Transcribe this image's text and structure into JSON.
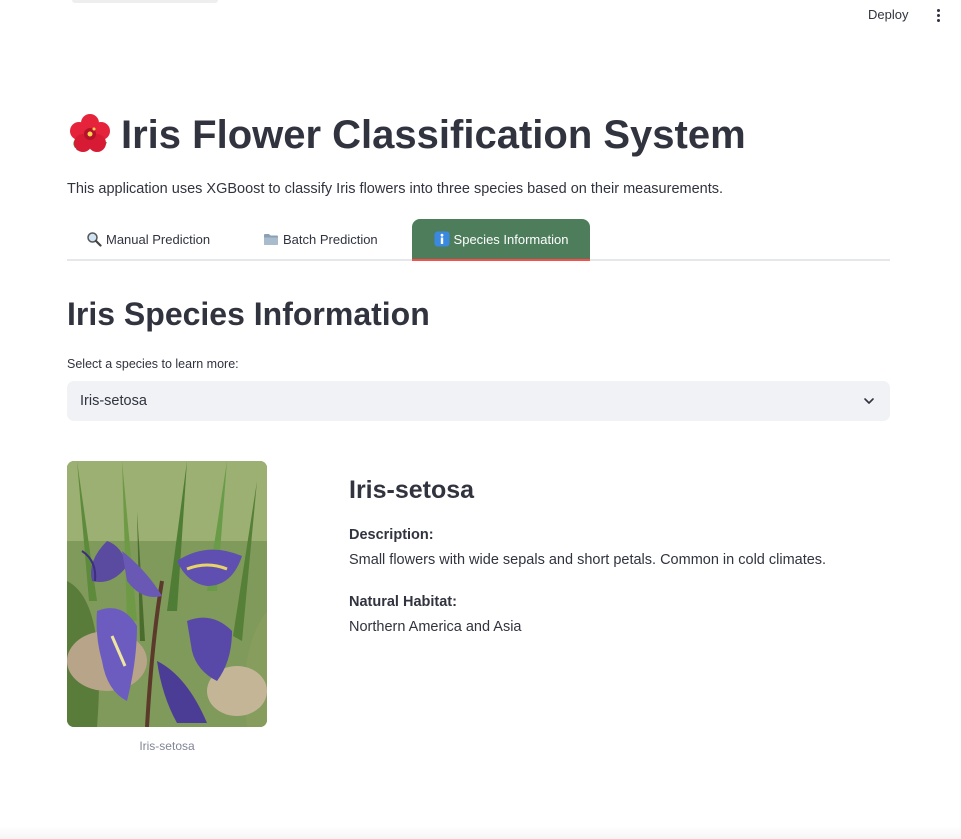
{
  "header": {
    "deploy_label": "Deploy",
    "menu_icon": "more-vertical-icon"
  },
  "app": {
    "title_icon": "hibiscus-icon",
    "title": "Iris Flower Classification System",
    "subtitle": "This application uses XGBoost to classify Iris flowers into three species based on their measurements."
  },
  "tabs": [
    {
      "label": "Manual Prediction",
      "icon": "magnifier-icon",
      "active": false
    },
    {
      "label": "Batch Prediction",
      "icon": "folder-icon",
      "active": false
    },
    {
      "label": "Species Information",
      "icon": "info-icon",
      "active": true
    }
  ],
  "species_section": {
    "title": "Iris Species Information",
    "select_label": "Select a species to learn more:",
    "selected_value": "Iris-setosa",
    "image_caption": "Iris-setosa",
    "species_name": "Iris-setosa",
    "description_label": "Description:",
    "description": "Small flowers with wide sepals and short petals. Common in cold climates.",
    "habitat_label": "Natural Habitat:",
    "habitat": "Northern America and Asia"
  },
  "colors": {
    "active_tab_bg": "#4e7d5c",
    "active_tab_underline": "#ff4b4b",
    "select_bg": "#f0f2f6",
    "text": "#31333f"
  }
}
